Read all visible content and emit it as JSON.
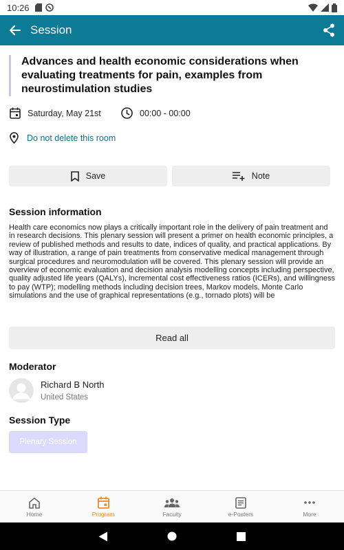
{
  "status_bar": {
    "time": "10:26"
  },
  "app_bar": {
    "title": "Session"
  },
  "session": {
    "title": "Advances and health economic considerations when evaluating treatments for pain, examples from neurostimulation studies",
    "date": "Saturday, May 21st",
    "time": "00:00 - 00:00",
    "room": "Do not delete this room"
  },
  "actions": {
    "save_label": "Save",
    "note_label": "Note"
  },
  "info": {
    "heading": "Session information",
    "description": "Health care economics now plays a critically important role in the delivery of pain treatment and in research decisions. This plenary session will present a primer on health economic principles, a review of published methods and results to date, indices of quality, and practical applications. By way of illustration, a range of pain treatments from conservative medical management through surgical procedures and neuromodulation will be covered. This plenary session will provide an overview of economic evaluation and decision analysis modelling concepts including perspective, quality adjusted life years (QALYs), incremental cost effectiveness ratios (ICERs), and willingness to pay (WTP); modelling methods including decision trees, Markov models, Monte Carlo simulations and the use of graphical representations (e.g., tornado plots) will be",
    "read_all_label": "Read all"
  },
  "moderator": {
    "heading": "Moderator",
    "name": "Richard B North",
    "country": "United States"
  },
  "session_type": {
    "heading": "Session Type",
    "value": "Plenary Session"
  },
  "bottom_nav": {
    "items": [
      {
        "label": "Home",
        "icon": "home-icon"
      },
      {
        "label": "Program",
        "icon": "calendar-icon",
        "active": true
      },
      {
        "label": "Faculty",
        "icon": "group-icon"
      },
      {
        "label": "e-Posters",
        "icon": "poster-icon"
      },
      {
        "label": "More",
        "icon": "more-icon"
      }
    ]
  },
  "colors": {
    "app_bar": "#0d7a96",
    "accent_active": "#f08a24",
    "chip": "#dcd9ff",
    "title_border": "#c9c3ee",
    "link": "#0d6e8a"
  }
}
